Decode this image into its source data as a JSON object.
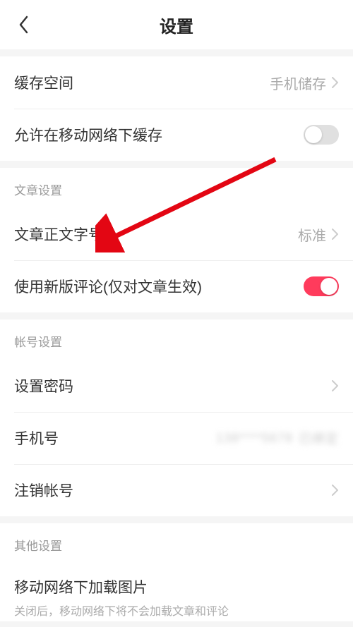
{
  "header": {
    "title": "设置"
  },
  "cache": {
    "storage_label": "缓存空间",
    "storage_value": "手机储存",
    "mobile_cache_label": "允许在移动网络下缓存"
  },
  "article": {
    "section_title": "文章设置",
    "font_size_label": "文章正文字号",
    "font_size_value": "标准",
    "new_comment_label": "使用新版评论(仅对文章生效)"
  },
  "account": {
    "section_title": "帐号设置",
    "password_label": "设置密码",
    "phone_label": "手机号",
    "phone_masked": "138****5678",
    "phone_masked2": "已绑定",
    "logout_label": "注销帐号"
  },
  "other": {
    "section_title": "其他设置",
    "load_img_label": "移动网络下加载图片",
    "load_img_desc": "关闭后，移动网络下将不会加载文章和评论"
  }
}
